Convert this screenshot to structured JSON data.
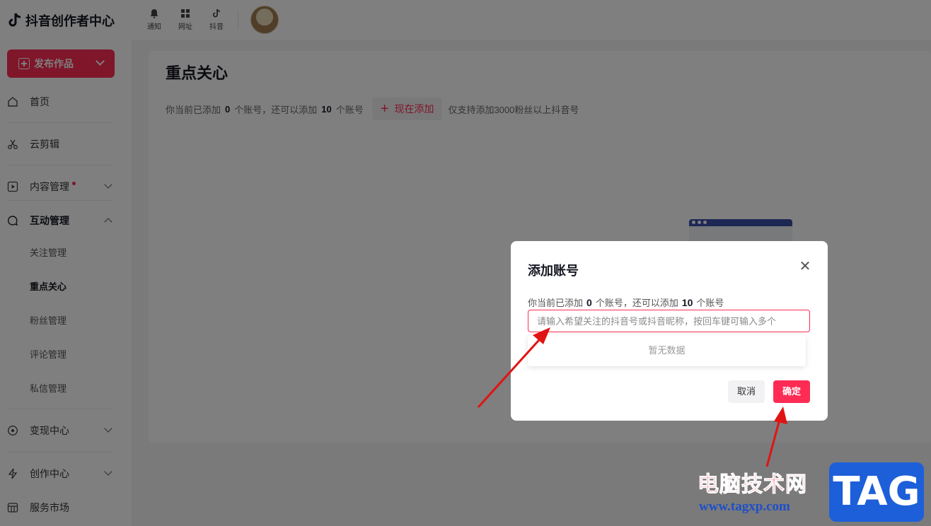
{
  "brand": {
    "name": "抖音创作者中心"
  },
  "publish": {
    "label": "发布作品"
  },
  "sidebar": {
    "items": [
      {
        "label": "首页",
        "icon": "home-icon"
      },
      {
        "label": "云剪辑",
        "icon": "scissors-icon"
      },
      {
        "label": "内容管理",
        "icon": "play-square-icon",
        "badge": true
      },
      {
        "label": "互动管理",
        "icon": "chat-icon",
        "expanded": true
      },
      {
        "label": "变现中心",
        "icon": "coin-icon"
      },
      {
        "label": "创作中心",
        "icon": "bolt-icon"
      },
      {
        "label": "服务市场",
        "icon": "store-icon"
      }
    ],
    "sub_items": [
      "关注管理",
      "重点关心",
      "粉丝管理",
      "评论管理",
      "私信管理"
    ],
    "active_sub": "重点关心"
  },
  "topbar": {
    "items": [
      {
        "label": "通知",
        "icon": "bell-icon"
      },
      {
        "label": "网址",
        "icon": "grid-icon"
      },
      {
        "label": "抖音",
        "icon": "tiktok-icon"
      }
    ]
  },
  "page": {
    "title": "重点关心",
    "info_prefix": "你当前已添加",
    "added_count": "0",
    "info_mid": "个账号，还可以添加",
    "remaining_count": "10",
    "info_suffix": "个账号",
    "add_button": "现在添加",
    "note": "仅支持添加3000粉丝以上抖音号"
  },
  "modal": {
    "title": "添加账号",
    "info_prefix": "你当前已添加",
    "added_count": "0",
    "info_mid": "个账号，还可以添加",
    "remaining_count": "10",
    "info_suffix": "个账号",
    "input_placeholder": "请输入希望关注的抖音号或抖音昵称，按回车键可输入多个",
    "empty_text": "暂无数据",
    "cancel_label": "取消",
    "confirm_label": "确定"
  },
  "watermark": {
    "cn": "电脑技术网",
    "url": "www.tagxp.com",
    "tag": "TAG"
  },
  "colors": {
    "accent": "#fe2c55",
    "annotation": "#e01414"
  }
}
